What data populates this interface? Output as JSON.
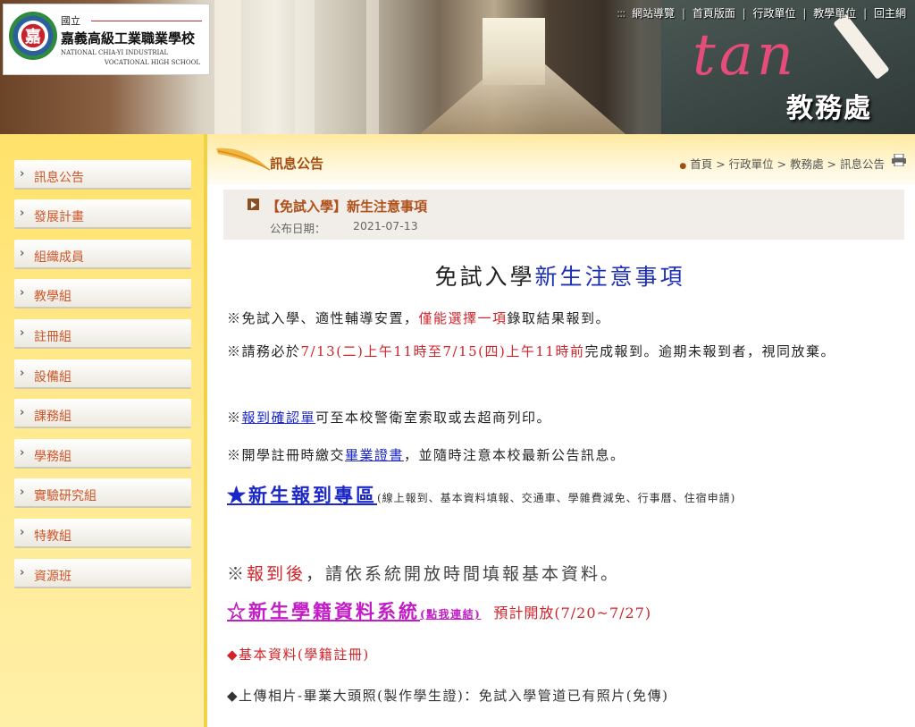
{
  "header": {
    "logo_emblem": "嘉",
    "logo_small": "國立",
    "school_name": "嘉義高級工業職業學校",
    "school_en_1": "NATIONAL CHIA-YI INDUSTRIAL",
    "school_en_2": "VOCATIONAL HIGH SCHOOL",
    "dept_name": "教務處",
    "chalk_text": "tan",
    "nav": {
      "dots": ":::",
      "items": [
        "網站導覽",
        "首頁版面",
        "行政單位",
        "教學單位",
        "回主網"
      ],
      "separator": "|"
    }
  },
  "sidebar": {
    "items": [
      {
        "label": "訊息公告"
      },
      {
        "label": "發展計畫"
      },
      {
        "label": "組織成員"
      },
      {
        "label": "教學組"
      },
      {
        "label": "註冊組"
      },
      {
        "label": "設備組"
      },
      {
        "label": "課務組"
      },
      {
        "label": "學務組"
      },
      {
        "label": "實驗研究組"
      },
      {
        "label": "特教組"
      },
      {
        "label": "資源班"
      }
    ]
  },
  "content": {
    "section_title": "訊息公告",
    "breadcrumb": "首頁 > 行政單位 > 教務處 > 訊息公告",
    "article": {
      "title": "【免試入學】新生注意事項",
      "pub_label": "公布日期：",
      "pub_date": "2021-07-13"
    },
    "body": {
      "heading_a": "免試入學",
      "heading_b": "新生注意事項",
      "p1_a": "※免試入學、適性輔導安置，",
      "p1_b": "僅能選擇一項",
      "p1_c": "錄取結果報到。",
      "p2_a": "※請務必於",
      "p2_b": "7/13(二)上午11時至7/15(四)上午11時前",
      "p2_c": "完成報到。逾期未報到者，視同放棄。",
      "p3_a": "※",
      "p3_b": "報到確認單",
      "p3_c": "可至本校警衛室索取或去超商列印。",
      "p4_a": "※開學註冊時繳交",
      "p4_b": "畢業證書",
      "p4_c": "，並隨時注意本校最新公告訊息。",
      "p5_link": "★新生報到專區",
      "p5_note": "(線上報到、基本資料填報、交通車、學雜費減免、行事曆、住宿申請)",
      "p6_a": "※",
      "p6_b": "報到後",
      "p6_c": "，請依系統開放時間填報基本資料。",
      "p7_link": "☆新生學籍資料系統",
      "p7_sub": "(點我連結)",
      "p7_sched": "預計開放(7/20~7/27)",
      "p8": "◆基本資料(學籍註冊)",
      "p9": "◆上傳相片-畢業大頭照(製作學生證)：免試入學管道已有照片(免傳)"
    }
  }
}
